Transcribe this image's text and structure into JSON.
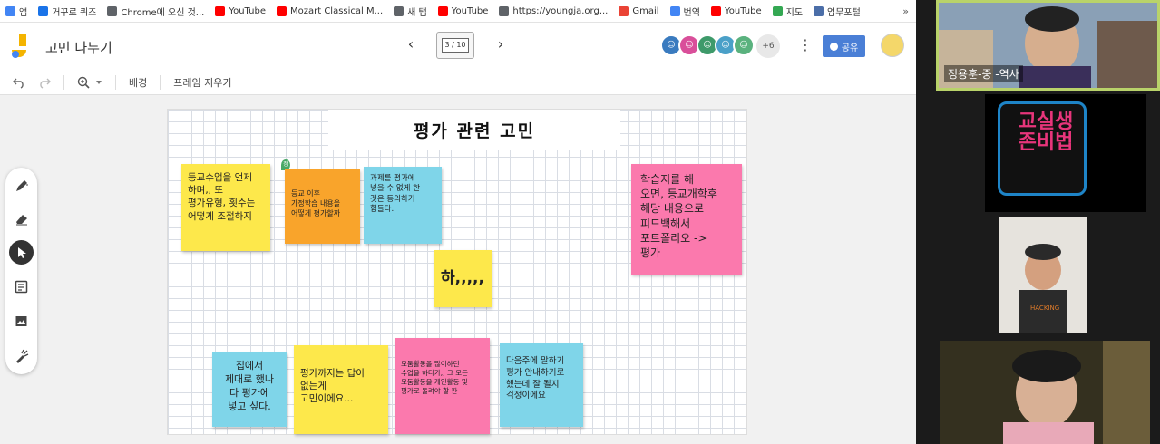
{
  "bookmarks": [
    {
      "label": "앱",
      "color": "#4285f4"
    },
    {
      "label": "거꾸로 퀴즈",
      "color": "#1a73e8"
    },
    {
      "label": "Chrome에 오신 것...",
      "color": "#5f6368"
    },
    {
      "label": "YouTube",
      "color": "#ff0000"
    },
    {
      "label": "Mozart Classical M...",
      "color": "#ff0000"
    },
    {
      "label": "새 탭",
      "color": "#5f6368"
    },
    {
      "label": "YouTube",
      "color": "#ff0000"
    },
    {
      "label": "https://youngja.org...",
      "color": "#5f6368"
    },
    {
      "label": "Gmail",
      "color": "#ea4335"
    },
    {
      "label": "번역",
      "color": "#4285f4"
    },
    {
      "label": "YouTube",
      "color": "#ff0000"
    },
    {
      "label": "지도",
      "color": "#34a853"
    },
    {
      "label": "업무포털",
      "color": "#4b6ea8"
    }
  ],
  "bookmarks_more": "»",
  "header": {
    "title": "고민 나누기",
    "frame_indicator": "3 / 10",
    "prev_icon": "‹",
    "next_icon": "›",
    "collab_more": "+6",
    "share_label": "공유"
  },
  "toolbar": {
    "background_label": "배경",
    "clear_frame_label": "프레임 지우기"
  },
  "board": {
    "title": "평가 관련 고민",
    "notes": [
      {
        "id": "n1",
        "color": "yellow",
        "text": "등교수업을 언제\n하며,, 또\n평가유형, 횟수는\n어떻게 조절하지"
      },
      {
        "id": "n2",
        "color": "orange",
        "text": "등교 이후\n가정학습 내용을\n어떻게 평가할까"
      },
      {
        "id": "n3",
        "color": "cyan",
        "text": "과제를 평가에\n넣을 수 없게 한\n것은 동의하기\n힘들다."
      },
      {
        "id": "n4",
        "color": "yellow",
        "text": "하,,,,,"
      },
      {
        "id": "n5",
        "color": "pink",
        "text": "학습지를 해\n오면, 등교개학후\n해당 내용으로\n피드백해서\n포트폴리오 ->\n평가"
      },
      {
        "id": "n6",
        "color": "cyan",
        "text": "집에서\n제대로 했나\n다 평가에\n넣고 싶다."
      },
      {
        "id": "n7",
        "color": "yellow",
        "text": "평가까지는 답이\n없는게\n고민이에요..."
      },
      {
        "id": "n8",
        "color": "pink",
        "text": "모둠활동을 많이하던\n수업을 하다가,, 그 모든\n모둠활동을 개인활동 및\n평가로 돌려야 할 판"
      },
      {
        "id": "n9",
        "color": "cyan",
        "text": "다음주에 말하기\n평가 안내하기로\n했는데 잘 될지\n걱정이에요"
      }
    ],
    "presence_label": "정"
  },
  "participants": [
    {
      "name": "정용훈-중 -역사"
    },
    {
      "logo_text": "교실생존비법"
    },
    {
      "name": ""
    },
    {
      "name": ""
    }
  ]
}
